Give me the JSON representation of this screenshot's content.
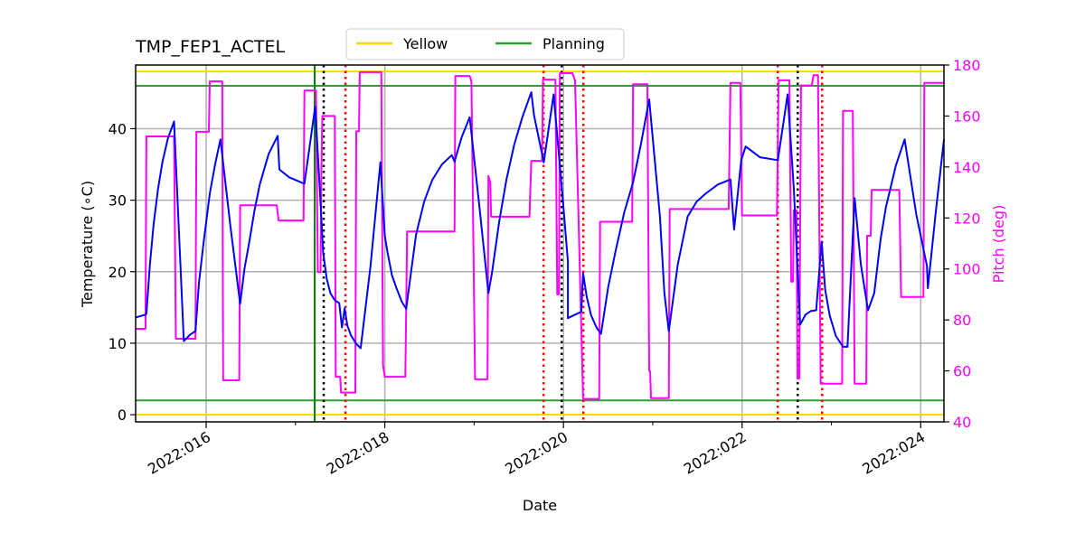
{
  "chart_data": {
    "type": "line",
    "title": "TMP_FEP1_ACTEL",
    "xlabel": "Date",
    "ylabel": "Temperature ($^\\circ$C)",
    "ylabel_display": "Temperature (∘C)",
    "y2label": "Pitch (deg)",
    "x_units": "day of year 2022",
    "xlim": [
      15.21,
      24.26
    ],
    "ylim": [
      -1,
      48.9
    ],
    "y2lim": [
      40,
      180
    ],
    "grid": true,
    "legend_position": "top-center-outside",
    "x_ticks": [
      {
        "value": 16,
        "label": "2022:016"
      },
      {
        "value": 18,
        "label": "2022:018"
      },
      {
        "value": 20,
        "label": "2022:020"
      },
      {
        "value": 22,
        "label": "2022:022"
      },
      {
        "value": 24,
        "label": "2022:024"
      }
    ],
    "x_minor_ticks": [
      17,
      19,
      21,
      23
    ],
    "y_ticks": [
      0,
      10,
      20,
      30,
      40
    ],
    "y2_ticks": [
      40,
      60,
      80,
      100,
      120,
      140,
      160,
      180
    ],
    "legend": [
      {
        "name": "Yellow",
        "color": "#ffd700"
      },
      {
        "name": "Planning",
        "color": "#2ca02c"
      }
    ],
    "limit_lines": [
      {
        "name": "yellow-high",
        "value": 48,
        "color": "#ffd700"
      },
      {
        "name": "planning-high",
        "value": 46,
        "color": "#2ca02c"
      },
      {
        "name": "planning-low",
        "value": 2,
        "color": "#2ca02c"
      },
      {
        "name": "yellow-low",
        "value": 0,
        "color": "#ffd700"
      }
    ],
    "vertical_lines": [
      {
        "name": "now-line",
        "x": 17.215,
        "color": "#008000",
        "style": "solid"
      },
      {
        "name": "black-marker",
        "x": 17.316,
        "color": "#000000",
        "style": "dotted"
      },
      {
        "name": "red-marker",
        "x": 17.56,
        "color": "#ff0000",
        "style": "dotted"
      },
      {
        "name": "red-marker",
        "x": 19.777,
        "color": "#ff0000",
        "style": "dotted"
      },
      {
        "name": "black-marker",
        "x": 19.98,
        "color": "#000000",
        "style": "dotted"
      },
      {
        "name": "red-marker",
        "x": 20.223,
        "color": "#ff0000",
        "style": "dotted"
      },
      {
        "name": "red-marker",
        "x": 22.4,
        "color": "#ff0000",
        "style": "dotted"
      },
      {
        "name": "black-marker",
        "x": 22.623,
        "color": "#000000",
        "style": "dotted"
      },
      {
        "name": "red-marker",
        "x": 22.896,
        "color": "#ff0000",
        "style": "dotted"
      }
    ],
    "series": [
      {
        "name": "Temperature",
        "axis": "left",
        "color": "#0000ff",
        "points": [
          [
            15.21,
            13.6
          ],
          [
            15.32,
            14.0
          ],
          [
            15.33,
            14.1
          ],
          [
            15.37,
            21.0
          ],
          [
            15.41,
            26.5
          ],
          [
            15.46,
            31.5
          ],
          [
            15.51,
            35.3
          ],
          [
            15.57,
            38.6
          ],
          [
            15.64,
            41.0
          ],
          [
            15.75,
            10.3
          ],
          [
            15.82,
            11.2
          ],
          [
            15.88,
            11.7
          ],
          [
            15.92,
            18.5
          ],
          [
            15.97,
            24.0
          ],
          [
            16.04,
            30.9
          ],
          [
            16.1,
            35.0
          ],
          [
            16.16,
            38.5
          ],
          [
            16.27,
            26.5
          ],
          [
            16.38,
            15.5
          ],
          [
            16.43,
            20.5
          ],
          [
            16.48,
            24.0
          ],
          [
            16.54,
            28.5
          ],
          [
            16.6,
            32.2
          ],
          [
            16.7,
            36.5
          ],
          [
            16.8,
            39.0
          ],
          [
            16.82,
            34.3
          ],
          [
            16.93,
            33.2
          ],
          [
            17.1,
            32.3
          ],
          [
            17.22,
            43.1
          ],
          [
            17.27,
            32.0
          ],
          [
            17.31,
            22.7
          ],
          [
            17.35,
            19.0
          ],
          [
            17.39,
            17.0
          ],
          [
            17.44,
            16.0
          ],
          [
            17.49,
            15.6
          ],
          [
            17.52,
            12.2
          ],
          [
            17.55,
            14.9
          ],
          [
            17.58,
            12.5
          ],
          [
            17.62,
            11.1
          ],
          [
            17.68,
            9.9
          ],
          [
            17.73,
            9.3
          ],
          [
            17.84,
            20.8
          ],
          [
            17.95,
            35.3
          ],
          [
            18.0,
            25.0
          ],
          [
            18.03,
            22.7
          ],
          [
            18.08,
            19.5
          ],
          [
            18.13,
            17.7
          ],
          [
            18.19,
            15.8
          ],
          [
            18.24,
            14.8
          ],
          [
            18.3,
            20.5
          ],
          [
            18.35,
            25.2
          ],
          [
            18.44,
            29.8
          ],
          [
            18.53,
            32.8
          ],
          [
            18.64,
            35.0
          ],
          [
            18.75,
            36.3
          ],
          [
            18.78,
            35.4
          ],
          [
            18.86,
            38.8
          ],
          [
            18.95,
            41.6
          ],
          [
            19.06,
            29.0
          ],
          [
            19.16,
            17.0
          ],
          [
            19.2,
            19.9
          ],
          [
            19.28,
            27.0
          ],
          [
            19.36,
            32.8
          ],
          [
            19.45,
            37.8
          ],
          [
            19.54,
            41.6
          ],
          [
            19.64,
            45.1
          ],
          [
            19.67,
            41.9
          ],
          [
            19.78,
            35.3
          ],
          [
            19.89,
            44.8
          ],
          [
            19.99,
            30.5
          ],
          [
            20.05,
            21.4
          ],
          [
            20.05,
            13.5
          ],
          [
            20.13,
            14.0
          ],
          [
            20.2,
            14.4
          ],
          [
            20.22,
            19.8
          ],
          [
            20.26,
            16.5
          ],
          [
            20.31,
            13.9
          ],
          [
            20.37,
            12.2
          ],
          [
            20.42,
            11.3
          ],
          [
            20.5,
            17.8
          ],
          [
            20.58,
            22.7
          ],
          [
            20.68,
            28.3
          ],
          [
            20.78,
            32.5
          ],
          [
            20.87,
            38.0
          ],
          [
            20.96,
            44.1
          ],
          [
            21.08,
            27.7
          ],
          [
            21.13,
            17.0
          ],
          [
            21.18,
            11.7
          ],
          [
            21.28,
            21.0
          ],
          [
            21.39,
            27.7
          ],
          [
            21.49,
            29.8
          ],
          [
            21.59,
            30.9
          ],
          [
            21.73,
            32.2
          ],
          [
            21.87,
            32.9
          ],
          [
            21.91,
            25.9
          ],
          [
            21.99,
            35.6
          ],
          [
            22.04,
            37.5
          ],
          [
            22.2,
            36.0
          ],
          [
            22.4,
            35.6
          ],
          [
            22.51,
            44.8
          ],
          [
            22.58,
            31.5
          ],
          [
            22.65,
            12.6
          ],
          [
            22.71,
            14.0
          ],
          [
            22.77,
            14.5
          ],
          [
            22.83,
            14.6
          ],
          [
            22.89,
            24.2
          ],
          [
            22.93,
            17.5
          ],
          [
            22.98,
            13.9
          ],
          [
            23.05,
            11.0
          ],
          [
            23.13,
            9.5
          ],
          [
            23.18,
            9.5
          ],
          [
            23.26,
            30.3
          ],
          [
            23.33,
            21.0
          ],
          [
            23.41,
            14.6
          ],
          [
            23.48,
            17.0
          ],
          [
            23.55,
            24.5
          ],
          [
            23.61,
            29.0
          ],
          [
            23.72,
            34.8
          ],
          [
            23.82,
            38.5
          ],
          [
            23.95,
            28.0
          ],
          [
            24.07,
            20.8
          ],
          [
            24.08,
            17.7
          ],
          [
            24.17,
            28.5
          ],
          [
            24.26,
            38.5
          ]
        ]
      },
      {
        "name": "Pitch",
        "axis": "right",
        "color": "#ff00ff",
        "points": [
          [
            15.21,
            76.5
          ],
          [
            15.32,
            76.5
          ],
          [
            15.33,
            152.0
          ],
          [
            15.64,
            152.0
          ],
          [
            15.66,
            72.6
          ],
          [
            15.88,
            72.6
          ],
          [
            15.89,
            153.8
          ],
          [
            16.03,
            153.8
          ],
          [
            16.04,
            173.6
          ],
          [
            16.18,
            173.6
          ],
          [
            16.19,
            56.3
          ],
          [
            16.37,
            56.3
          ],
          [
            16.38,
            125.0
          ],
          [
            16.79,
            125.0
          ],
          [
            16.81,
            119.0
          ],
          [
            17.09,
            119.0
          ],
          [
            17.1,
            170.0
          ],
          [
            17.23,
            170.0
          ],
          [
            17.25,
            98.8
          ],
          [
            17.28,
            98.8
          ],
          [
            17.29,
            139.0
          ],
          [
            17.3,
            160.0
          ],
          [
            17.44,
            160.0
          ],
          [
            17.45,
            57.7
          ],
          [
            17.5,
            57.7
          ],
          [
            17.51,
            51.5
          ],
          [
            17.67,
            51.5
          ],
          [
            17.68,
            154.0
          ],
          [
            17.71,
            154.0
          ],
          [
            17.72,
            177.2
          ],
          [
            17.96,
            177.2
          ],
          [
            17.98,
            62.4
          ],
          [
            18.0,
            57.7
          ],
          [
            18.23,
            57.7
          ],
          [
            18.25,
            114.7
          ],
          [
            18.78,
            114.7
          ],
          [
            18.79,
            175.7
          ],
          [
            18.95,
            175.7
          ],
          [
            18.97,
            173.6
          ],
          [
            19.01,
            56.7
          ],
          [
            19.15,
            56.7
          ],
          [
            19.16,
            136.5
          ],
          [
            19.18,
            134.0
          ],
          [
            19.19,
            120.5
          ],
          [
            19.62,
            120.5
          ],
          [
            19.64,
            142.4
          ],
          [
            19.76,
            142.4
          ],
          [
            19.77,
            174.3
          ],
          [
            19.91,
            174.3
          ],
          [
            19.93,
            90.0
          ],
          [
            19.95,
            90.0
          ],
          [
            19.96,
            176.8
          ],
          [
            20.1,
            176.8
          ],
          [
            20.13,
            174.0
          ],
          [
            20.22,
            49.0
          ],
          [
            20.4,
            49.0
          ],
          [
            20.41,
            118.5
          ],
          [
            20.77,
            118.5
          ],
          [
            20.78,
            172.5
          ],
          [
            20.94,
            172.5
          ],
          [
            20.96,
            60.0
          ],
          [
            20.97,
            60.0
          ],
          [
            20.98,
            49.3
          ],
          [
            21.18,
            49.3
          ],
          [
            21.19,
            123.5
          ],
          [
            21.85,
            123.5
          ],
          [
            21.87,
            173.0
          ],
          [
            21.98,
            173.0
          ],
          [
            22.0,
            121.0
          ],
          [
            22.39,
            121.0
          ],
          [
            22.41,
            174.0
          ],
          [
            22.53,
            174.0
          ],
          [
            22.55,
            95.0
          ],
          [
            22.57,
            95.0
          ],
          [
            22.58,
            123.0
          ],
          [
            22.61,
            123.0
          ],
          [
            22.62,
            57.0
          ],
          [
            22.64,
            57.0
          ],
          [
            22.66,
            172.0
          ],
          [
            22.78,
            172.0
          ],
          [
            22.8,
            176.0
          ],
          [
            22.85,
            176.0
          ],
          [
            22.88,
            55.0
          ],
          [
            23.12,
            55.0
          ],
          [
            23.13,
            162.0
          ],
          [
            23.24,
            162.0
          ],
          [
            23.26,
            55.0
          ],
          [
            23.39,
            55.0
          ],
          [
            23.4,
            113.0
          ],
          [
            23.44,
            113.0
          ],
          [
            23.45,
            131.0
          ],
          [
            23.76,
            131.0
          ],
          [
            23.78,
            89.0
          ],
          [
            24.03,
            89.0
          ],
          [
            24.04,
            173.0
          ],
          [
            24.26,
            173.0
          ]
        ]
      }
    ]
  }
}
